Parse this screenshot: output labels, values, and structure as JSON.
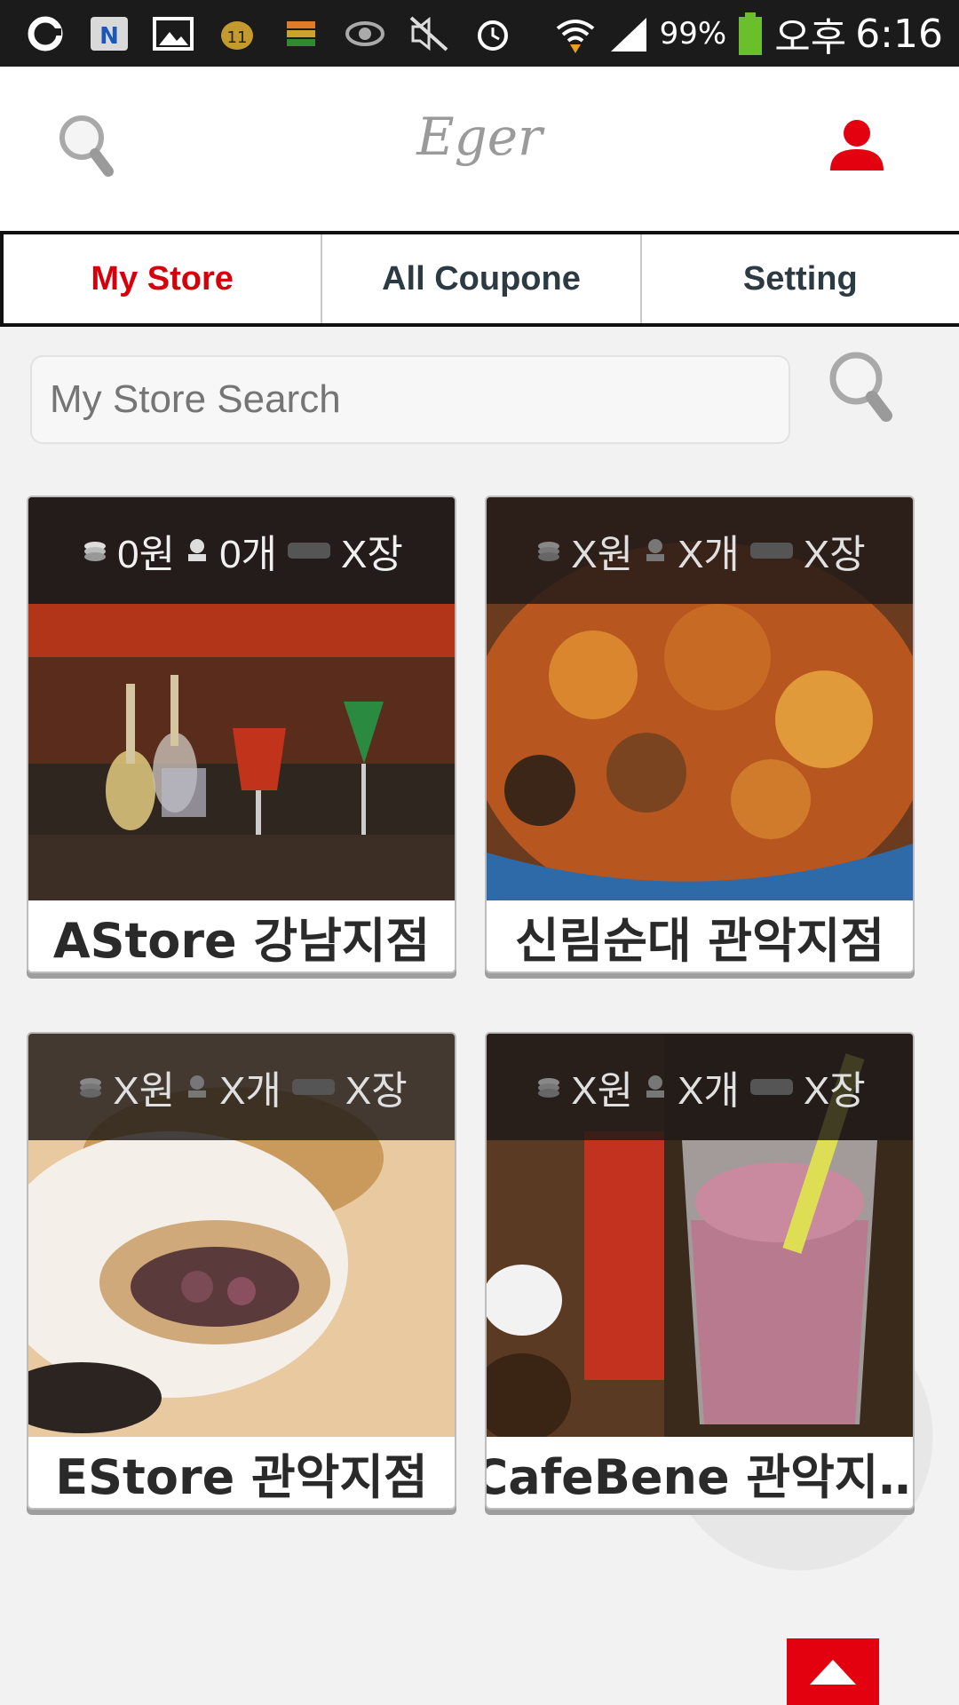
{
  "status_bar": {
    "battery": "99%",
    "am_pm": "오후",
    "time": "6:16",
    "left_icons": [
      "g-app-icon",
      "n-app-icon",
      "gallery-icon",
      "kakao-icon",
      "stack-icon",
      "eye-icon",
      "mute-icon",
      "alarm-icon"
    ],
    "right_icons": [
      "wifi-icon",
      "signal-icon",
      "battery-icon"
    ]
  },
  "header": {
    "logo": "Eger",
    "search_icon": "search-icon",
    "profile_icon": "user-icon",
    "accent_color": "#e3000f"
  },
  "tabs": [
    {
      "label": "My Store",
      "active": true
    },
    {
      "label": "All Coupone",
      "active": false
    },
    {
      "label": "Setting",
      "active": false
    }
  ],
  "search": {
    "placeholder": "My Store Search"
  },
  "stores": [
    {
      "name": "AStore 강남지점",
      "points": "0원",
      "stamps": "0개",
      "coupons": "X장"
    },
    {
      "name": "신림순대 관악지점",
      "points": "X원",
      "stamps": "X개",
      "coupons": "X장"
    },
    {
      "name": "EStore 관악지점",
      "points": "X원",
      "stamps": "X개",
      "coupons": "X장"
    },
    {
      "name": "CafeBene 관악지…",
      "points": "X원",
      "stamps": "X개",
      "coupons": "X장"
    }
  ],
  "scroll_top_icon": "arrow-up-icon"
}
